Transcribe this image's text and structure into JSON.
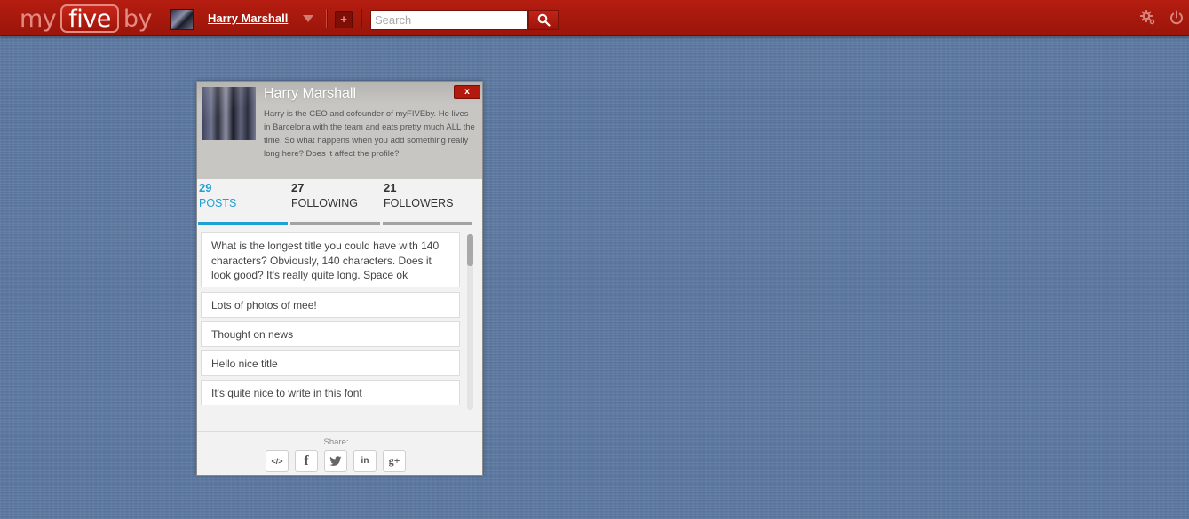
{
  "header": {
    "logo": {
      "left": "my",
      "box": "five",
      "right": "by"
    },
    "user_name": "Harry Marshall",
    "search_placeholder": "Search",
    "add_label": "+"
  },
  "profile": {
    "name": "Harry Marshall",
    "close_label": "x",
    "bio": "Harry is the CEO and cofounder of myFIVEby. He lives in Barcelona with the team and eats pretty much ALL the time. So what happens when you add something really long here? Does it affect the profile?",
    "stats": [
      {
        "count": "29",
        "label": "POSTS",
        "active": true
      },
      {
        "count": "27",
        "label": "FOLLOWING",
        "active": false
      },
      {
        "count": "21",
        "label": "FOLLOWERS",
        "active": false
      }
    ],
    "posts": [
      "What is the longest title you could have with 140 characters? Obviously, 140 characters. Does it look good? It's really quite long. Space ok",
      "Lots of photos of mee!",
      "Thought on news",
      "Hello nice title",
      "It's quite nice to write in this font"
    ],
    "share": {
      "label": "Share:",
      "buttons": [
        {
          "icon": "embed-icon",
          "glyph": "</>"
        },
        {
          "icon": "facebook-icon",
          "glyph": "f"
        },
        {
          "icon": "twitter-icon",
          "glyph": ""
        },
        {
          "icon": "linkedin-icon",
          "glyph": "in"
        },
        {
          "icon": "google-plus-icon",
          "glyph": "g+"
        }
      ]
    }
  },
  "colors": {
    "topbar": "#b51d10",
    "accent": "#20a1d6",
    "background": "#5d7aa3"
  }
}
